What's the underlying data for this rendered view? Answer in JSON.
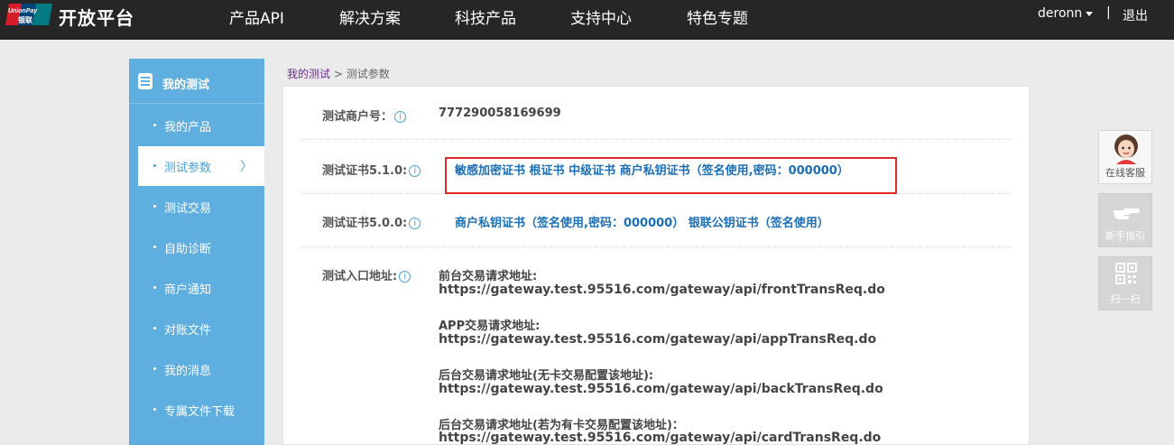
{
  "header": {
    "logo_top": "UnionPay",
    "logo_bottom": "银联",
    "brand": "开放平台",
    "nav": [
      "产品API",
      "解决方案",
      "科技产品",
      "支持中心",
      "特色专题"
    ],
    "username": "deronn",
    "separator": "|",
    "logout": "退出"
  },
  "sidebar": {
    "title": "我的测试",
    "items": [
      {
        "label": "我的产品",
        "active": false
      },
      {
        "label": "测试参数",
        "active": true,
        "chevron": "〉"
      },
      {
        "label": "测试交易",
        "active": false
      },
      {
        "label": "自助诊断",
        "active": false
      },
      {
        "label": "商户通知",
        "active": false
      },
      {
        "label": "对账文件",
        "active": false
      },
      {
        "label": "我的消息",
        "active": false
      },
      {
        "label": "专属文件下载",
        "active": false
      }
    ]
  },
  "breadcrumb": {
    "parent": "我的测试",
    "separator": ">",
    "current": "测试参数"
  },
  "params": {
    "info_glyph": "i",
    "merchant": {
      "label": "测试商户号：",
      "value": "777290058169699"
    },
    "cert510": {
      "label": "测试证书5.1.0:",
      "links": [
        "敏感加密证书",
        "根证书",
        "中级证书",
        "商户私钥证书（签名使用,密码：000000）"
      ]
    },
    "cert500": {
      "label": "测试证书5.0.0:",
      "links": [
        "商户私钥证书（签名使用,密码：000000）",
        "银联公钥证书（签名使用）"
      ]
    },
    "entry": {
      "label": "测试入口地址:",
      "items": [
        {
          "title": "前台交易请求地址:",
          "url": "https://gateway.test.95516.com/gateway/api/frontTransReq.do"
        },
        {
          "title": "APP交易请求地址:",
          "url": "https://gateway.test.95516.com/gateway/api/appTransReq.do"
        },
        {
          "title": "后台交易请求地址(无卡交易配置该地址):",
          "url": "https://gateway.test.95516.com/gateway/api/backTransReq.do"
        },
        {
          "title": "后台交易请求地址(若为有卡交易配置该地址)：",
          "url": "https://gateway.test.95516.com/gateway/api/cardTransReq.do"
        }
      ]
    }
  },
  "widgets": {
    "customer_service": "在线客服",
    "guide": "新手指引",
    "scan": "扫一扫"
  },
  "colors": {
    "topbar": "#262626",
    "sidebar": "#5eaee0",
    "link": "#1a6fb7",
    "highlight": "#e02a2a",
    "breadcrumb_link": "#6c2d8c"
  }
}
